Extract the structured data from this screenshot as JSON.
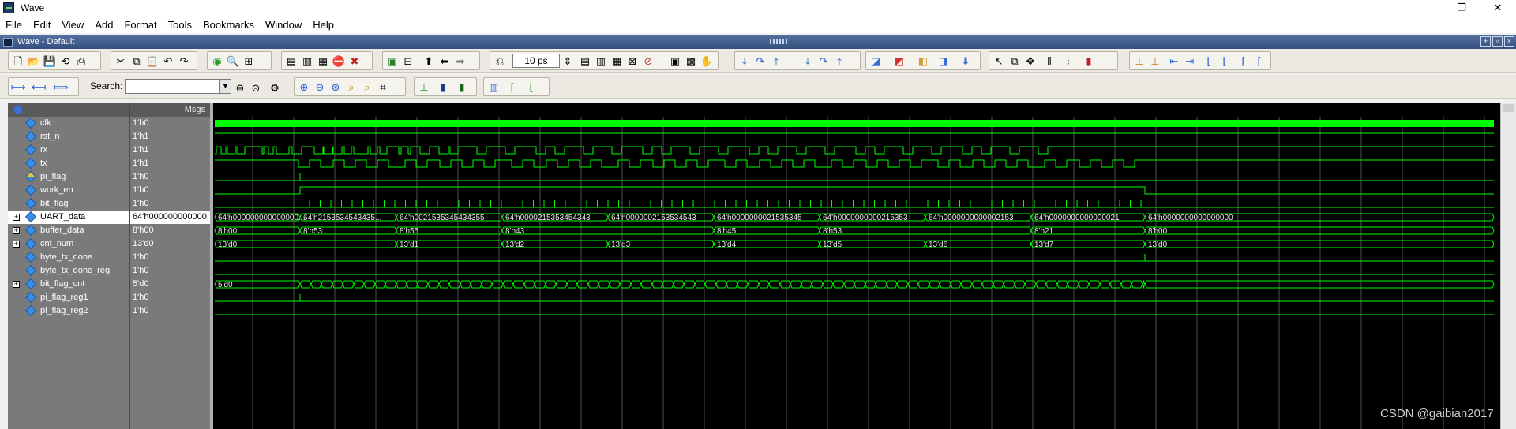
{
  "window": {
    "title": "Wave",
    "controls": [
      "—",
      "❐",
      "✕"
    ]
  },
  "menu": [
    "File",
    "Edit",
    "View",
    "Add",
    "Format",
    "Tools",
    "Bookmarks",
    "Window",
    "Help"
  ],
  "wave_header": {
    "title": "Wave - Default"
  },
  "toolbar": {
    "time_value": "10 ps",
    "search_label": "Search:",
    "search_placeholder": ""
  },
  "panes": {
    "msgs_header": "Msgs"
  },
  "signals": [
    {
      "name": "clk",
      "value": "1'h0",
      "expand": false,
      "icon": "signal"
    },
    {
      "name": "rst_n",
      "value": "1'h1",
      "expand": false,
      "icon": "signal"
    },
    {
      "name": "rx",
      "value": "1'h1",
      "expand": false,
      "icon": "signal"
    },
    {
      "name": "tx",
      "value": "1'h1",
      "expand": false,
      "icon": "signal"
    },
    {
      "name": "pi_flag",
      "value": "1'h0",
      "expand": false,
      "icon": "input"
    },
    {
      "name": "work_en",
      "value": "1'h0",
      "expand": false,
      "icon": "signal"
    },
    {
      "name": "bit_flag",
      "value": "1'h0",
      "expand": false,
      "icon": "signal"
    },
    {
      "name": "UART_data",
      "value": "64'h000000000000...",
      "expand": true,
      "icon": "signal",
      "selected": true
    },
    {
      "name": "buffer_data",
      "value": "8'h00",
      "expand": true,
      "icon": "signal"
    },
    {
      "name": "cnt_num",
      "value": "13'd0",
      "expand": true,
      "icon": "signal"
    },
    {
      "name": "byte_tx_done",
      "value": "1'h0",
      "expand": false,
      "icon": "signal"
    },
    {
      "name": "byte_tx_done_reg",
      "value": "1'h0",
      "expand": false,
      "icon": "signal"
    },
    {
      "name": "bit_flag_cnt",
      "value": "5'd0",
      "expand": true,
      "icon": "signal"
    },
    {
      "name": "pi_flag_reg1",
      "value": "1'h0",
      "expand": false,
      "icon": "signal"
    },
    {
      "name": "pi_flag_reg2",
      "value": "1'h0",
      "expand": false,
      "icon": "signal"
    }
  ],
  "bus_values": {
    "UART_data": [
      "64'h000000000000000...",
      "64'h2153534543435...",
      "64'h0021535345434355",
      "64'h0000215353454343",
      "64'h0000002153534543",
      "64'h0000000021535345",
      "64'h0000000000215353",
      "64'h0000000000002153",
      "64'h0000000000000021",
      "64'h0000000000000000"
    ],
    "buffer_data": [
      "8'h00",
      "8'h53",
      "8'h55",
      "8'h43",
      "8'h45",
      "8'h53",
      "8'h21",
      "8'h00"
    ],
    "cnt_num": [
      "13'd0",
      "13'd1",
      "13'd2",
      "13'd3",
      "13'd4",
      "13'd5",
      "13'd6",
      "13'd7",
      "13'd0"
    ],
    "bit_flag_cnt": [
      "5'd0",
      "5'd0"
    ]
  },
  "colors": {
    "wave": "#00ff00",
    "background": "#000000",
    "grid": "#505050"
  },
  "watermark": "CSDN @gaibian2017"
}
